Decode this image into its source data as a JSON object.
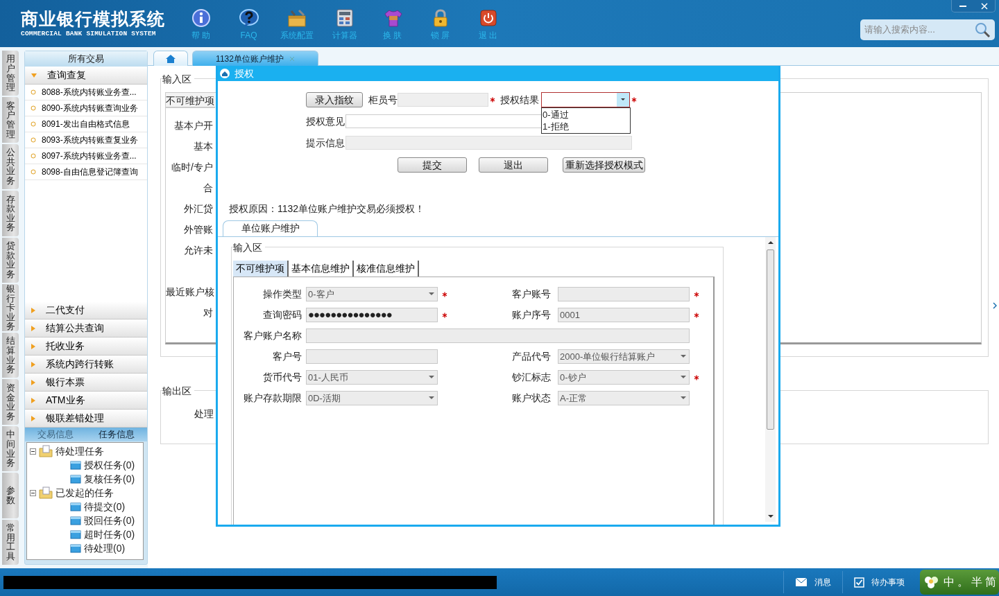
{
  "app": {
    "title": "商业银行模拟系统",
    "subtitle": "COMMERCIAL BANK SIMULATION SYSTEM"
  },
  "toolbar": [
    {
      "kind": "info",
      "label": "帮 助"
    },
    {
      "kind": "faq",
      "label": "FAQ"
    },
    {
      "kind": "config",
      "label": "系统配置"
    },
    {
      "kind": "calculator",
      "label": "计算器"
    },
    {
      "kind": "skin",
      "label": "换 肤"
    },
    {
      "kind": "lock",
      "label": "锁 屏"
    },
    {
      "kind": "exit",
      "label": "退 出"
    }
  ],
  "search": {
    "placeholder": "请输入搜索内容..."
  },
  "side_tabs": [
    "用户管理",
    "客户管理",
    "公共业务",
    "存款业务",
    "贷款业务",
    "银行卡业务",
    "结算业务",
    "资金业务",
    "中间业务",
    "参数",
    "常用工具"
  ],
  "sidebar": {
    "title": "所有交易",
    "groups": [
      {
        "label": "查询查复",
        "expanded": true,
        "items": [
          "8088-系统内转账业务查...",
          "8090-系统内转账查询业务",
          "8091-发出自由格式信息",
          "8093-系统内转账查复业务",
          "8097-系统内转账业务查...",
          "8098-自由信息登记簿查询"
        ]
      },
      {
        "label": "二代支付",
        "expanded": false
      },
      {
        "label": "结算公共查询",
        "expanded": false
      },
      {
        "label": "托收业务",
        "expanded": false
      },
      {
        "label": "系统内跨行转账",
        "expanded": false
      },
      {
        "label": "银行本票",
        "expanded": false
      },
      {
        "label": "ATM业务",
        "expanded": false
      },
      {
        "label": "银联差错处理",
        "expanded": false
      }
    ]
  },
  "info_tabs": [
    {
      "label": "交易信息",
      "selected": false
    },
    {
      "label": "任务信息",
      "selected": true
    }
  ],
  "task_tree": [
    {
      "label": "待处理任务",
      "expanded": true,
      "children": [
        {
          "label": "授权任务(0)"
        },
        {
          "label": "复核任务(0)"
        }
      ]
    },
    {
      "label": "已发起的任务",
      "expanded": true,
      "children": [
        {
          "label": "待提交(0)"
        },
        {
          "label": "驳回任务(0)"
        },
        {
          "label": "超时任务(0)"
        },
        {
          "label": "待处理(0)"
        }
      ]
    }
  ],
  "doc_tabs": [
    {
      "kind": "home",
      "selected": false
    },
    {
      "kind": "text",
      "label": "1132单位账户维护",
      "selected": true
    }
  ],
  "background_form": {
    "input_legend": "输入区",
    "tab": "不可维护项",
    "label_groups": [
      [
        "基本户开",
        "基本",
        "临时/专户",
        "合",
        "外汇贷",
        "外管账",
        "允许未"
      ],
      [
        "最近账户核",
        "对"
      ]
    ],
    "output_legend": "输出区",
    "output_labels": [
      "处理"
    ]
  },
  "dialog": {
    "title": "授权",
    "fingerprint_button": "录入指纹",
    "teller_label": "柜员号",
    "result_label": "授权结果",
    "result_options": [
      "0-通过",
      "1-拒绝"
    ],
    "opinion_label": "授权意见",
    "hint_label": "提示信息",
    "buttons": [
      "提交",
      "退出",
      "重新选择授权模式"
    ],
    "reason": "授权原因：1132单位账户维护交易必须授权！",
    "tab": "单位账户维护",
    "legend": "输入区",
    "form_tabs": [
      {
        "label": "不可维护项",
        "selected": true
      },
      {
        "label": "基本信息维护",
        "selected": false
      },
      {
        "label": "核准信息维护",
        "selected": false
      }
    ],
    "rows": [
      [
        {
          "label": "操作类型",
          "kind": "select",
          "value": "0-客户",
          "required": true
        },
        {
          "label": "客户账号",
          "kind": "text",
          "required": true
        }
      ],
      [
        {
          "label": "查询密码",
          "kind": "password",
          "value": "●●●●●●●●●●●●●●●",
          "required": true
        },
        {
          "label": "账户序号",
          "kind": "text",
          "value": "0001",
          "required": true
        }
      ],
      [
        {
          "label": "客户账户名称",
          "kind": "wide",
          "required": false
        }
      ],
      [
        {
          "label": "客户号",
          "kind": "text",
          "required": false
        },
        {
          "label": "产品代号",
          "kind": "select",
          "value": "2000-单位银行结算账户",
          "required": false
        }
      ],
      [
        {
          "label": "货币代号",
          "kind": "select",
          "value": "01-人民币",
          "required": false
        },
        {
          "label": "钞汇标志",
          "kind": "select",
          "value": "0-钞户",
          "required": true
        }
      ],
      [
        {
          "label": "账户存款期限",
          "kind": "select",
          "value": "0D-活期",
          "required": false
        },
        {
          "label": "账户状态",
          "kind": "select",
          "value": "A-正常",
          "required": false
        }
      ]
    ]
  },
  "status_bar": {
    "items": [
      {
        "kind": "message",
        "label": "消息"
      },
      {
        "kind": "todo",
        "label": "待办事项"
      }
    ],
    "ime": [
      "中",
      "。",
      "半",
      "简"
    ]
  }
}
